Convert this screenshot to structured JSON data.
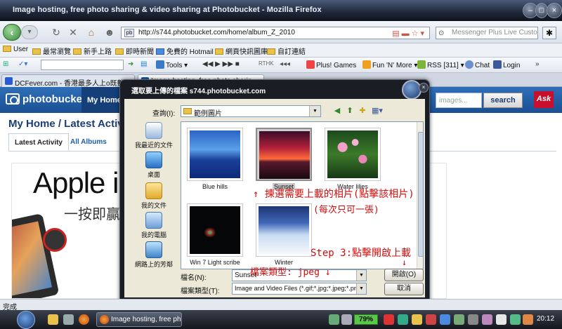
{
  "window": {
    "title": "Image hosting, free photo sharing & video sharing at Photobucket - Mozilla Firefox",
    "controls": [
      "–",
      "□",
      "×"
    ]
  },
  "navbar": {
    "url": "http://s744.photobucket.com/home/album_Z_2010",
    "search_placeholder": "Messenger Plus Live Custom"
  },
  "bookmarks": [
    "User",
    "最常瀏覽",
    "新手上路",
    "即時新聞",
    "免費的 Hotmail",
    "網頁快訊圖庫",
    "自訂連結"
  ],
  "toolbar2": {
    "tools": "Tools",
    "player_label": "RTHK",
    "plus_games": "Plus! Games",
    "fun_more": "Fun 'N' More",
    "rss": "RSS [311]",
    "chat": "Chat",
    "login": "Login"
  },
  "tabs": [
    {
      "label": "DCFever.com - 香港最多人上o既數碼..."
    },
    {
      "label": "Image hosting, free photo sharin..."
    }
  ],
  "photobucket": {
    "logo": "photobucket",
    "my_home": "My Home",
    "search_placeholder": "images...",
    "search_button": "search",
    "ask": "Ask",
    "breadcrumb": "My Home / Latest Activ",
    "tab_latest": "Latest Activity",
    "tab_albums": "All Albums",
    "ad_title": "Apple i",
    "ad_subtitle": "一按即贏"
  },
  "dialog": {
    "title": "選取要上傳的檔案 s744.photobucket.com",
    "lookin_label": "查詢(I):",
    "lookin_value": "範例圖片",
    "places": [
      "我最近的文件",
      "桌面",
      "我的文件",
      "我的電腦",
      "網路上的芳鄰"
    ],
    "files": [
      {
        "name": "Blue hills"
      },
      {
        "name": "Sunset"
      },
      {
        "name": "Water lilies"
      },
      {
        "name": "Win 7 Light scribe"
      },
      {
        "name": "Winter"
      }
    ],
    "filename_label": "檔名(N):",
    "filename_value": "Sunset",
    "filetype_label": "檔案類型(T):",
    "filetype_value": "Image and Video Files (*.gif;*.jpg;*.jpeg;*.png",
    "open_button": "開啟(O)",
    "cancel_button": "取消"
  },
  "annotations": {
    "select_line1": "↑ 揀選需要上載的相片(點擊該相片)",
    "select_line2": "(每次只可一張)",
    "step3": "Step 3:點擊開啟上載",
    "step3_arrow": "↓",
    "file_type": "檔案類型: jpeg ↓"
  },
  "statusbar": {
    "text": "完成"
  },
  "taskbar": {
    "firefox_task": "Image hosting, free ph...",
    "battery": "79%",
    "clock": "20:12"
  }
}
